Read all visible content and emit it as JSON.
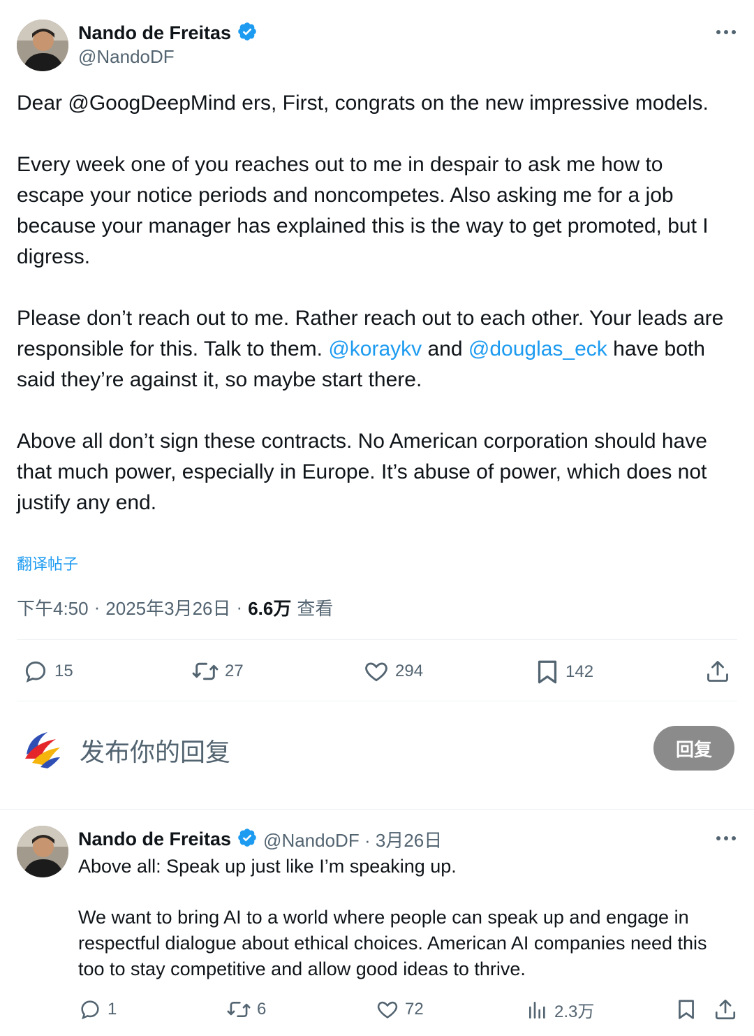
{
  "tweet": {
    "author_name": "Nando de Freitas",
    "author_handle": "@NandoDF",
    "paragraphs": {
      "p1": "Dear @GoogDeepMind ers, First, congrats on the new impressive models.",
      "p2": "Every week one of you reaches out to me in despair to ask me how to escape your notice periods and noncompetes. Also asking me for a job because your manager has explained this is the way to get promoted, but I digress.",
      "p3_a": "Please don’t reach out to me. Rather reach out to each other. Your leads are responsible for this. Talk to them. ",
      "p3_mention1": "@koraykv",
      "p3_b": " and ",
      "p3_mention2": "@douglas_eck",
      "p3_c": " have both said they’re against it, so maybe start there.",
      "p4": "Above all don’t sign these contracts. No American corporation should have that much power, especially in Europe. It’s abuse of power, which does not justify any end."
    },
    "translate_label": "翻译帖子",
    "time": "下午4:50",
    "sep": "·",
    "date": "2025年3月26日",
    "views_count": "6.6万",
    "views_label": "查看",
    "stats": {
      "replies": "15",
      "retweets": "27",
      "likes": "294",
      "bookmarks": "142"
    }
  },
  "compose": {
    "placeholder": "发布你的回复",
    "button_label": "回复"
  },
  "reply": {
    "author_name": "Nando de Freitas",
    "handle_and_date": "@NandoDF · 3月26日",
    "line1": "Above all: Speak up just like I’m speaking up.",
    "line2": "We want to bring AI to a world where people can speak up and engage in respectful dialogue about ethical choices. American AI companies need this too to stay competitive and allow good ideas to thrive.",
    "stats": {
      "replies": "1",
      "retweets": "6",
      "likes": "72",
      "views": "2.3万"
    }
  },
  "colors": {
    "accent": "#1d9bf0",
    "text": "#0f1419",
    "secondary": "#536471",
    "divider": "#eff3f4",
    "reply_button": "#8b8b8b"
  },
  "icons": [
    "verified-badge-icon",
    "more-icon",
    "reply-icon",
    "retweet-icon",
    "like-icon",
    "bookmark-icon",
    "share-icon",
    "views-icon"
  ]
}
